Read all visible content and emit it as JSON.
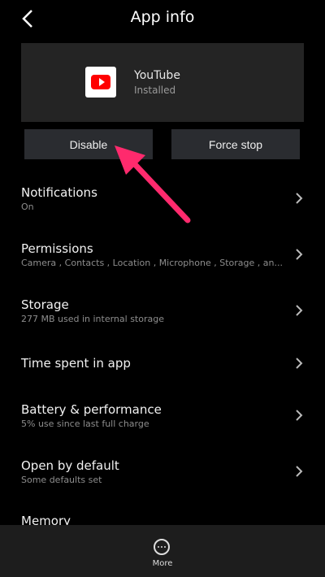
{
  "header": {
    "title": "App info"
  },
  "app": {
    "name": "YouTube",
    "status": "Installed"
  },
  "buttons": {
    "disable": "Disable",
    "force_stop": "Force stop"
  },
  "settings": [
    {
      "title": "Notifications",
      "subtitle": "On"
    },
    {
      "title": "Permissions",
      "subtitle": "Camera , Contacts , Location , Microphone , Storage , an..."
    },
    {
      "title": "Storage",
      "subtitle": "277 MB used in internal storage"
    },
    {
      "title": "Time spent in app",
      "subtitle": ""
    },
    {
      "title": "Battery & performance",
      "subtitle": "5% use since last full charge"
    },
    {
      "title": "Open by default",
      "subtitle": "Some defaults set"
    },
    {
      "title": "Memory",
      "subtitle": ""
    }
  ],
  "bottom_bar": {
    "more_label": "More"
  },
  "colors": {
    "background": "#000000",
    "card": "#242424",
    "button": "#2a2c30",
    "accent_arrow": "#ff2a6d",
    "youtube_red": "#ff0000"
  }
}
